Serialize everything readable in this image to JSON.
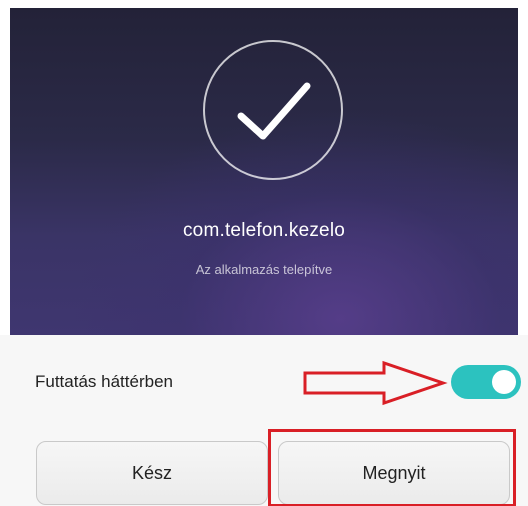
{
  "hero": {
    "icon": "checkmark-icon",
    "package_name": "com.telefon.kezelo",
    "status": "Az alkalmazás telepítve"
  },
  "options": {
    "run_in_background_label": "Futtatás háttérben",
    "run_in_background_on": true,
    "toggle_color": "#2cc2bf"
  },
  "actions": {
    "done_label": "Kész",
    "open_label": "Megnyit"
  },
  "annotations": {
    "color": "#d91f26",
    "arrow_target": "run-in-background-toggle",
    "box_target": "open-button"
  }
}
